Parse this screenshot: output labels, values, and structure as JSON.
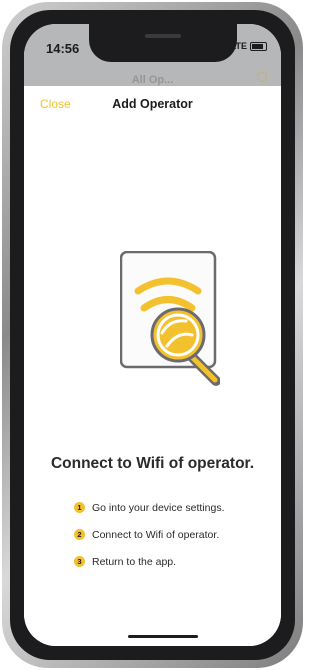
{
  "status_bar": {
    "time": "14:56",
    "network": "LTE"
  },
  "background": {
    "title": "All Op..."
  },
  "sheet": {
    "close_label": "Close",
    "title": "Add Operator"
  },
  "content": {
    "heading": "Connect to Wifi of operator.",
    "steps": [
      {
        "number": "1",
        "text": "Go into your device settings."
      },
      {
        "number": "2",
        "text": "Connect to Wifi of operator."
      },
      {
        "number": "3",
        "text": "Return to the app."
      }
    ]
  },
  "illustration": {
    "icon": "wifi-search-icon"
  },
  "colors": {
    "accent": "#f4c12e",
    "text": "#2b2b2d",
    "status_bg": "#b6b7b9"
  }
}
